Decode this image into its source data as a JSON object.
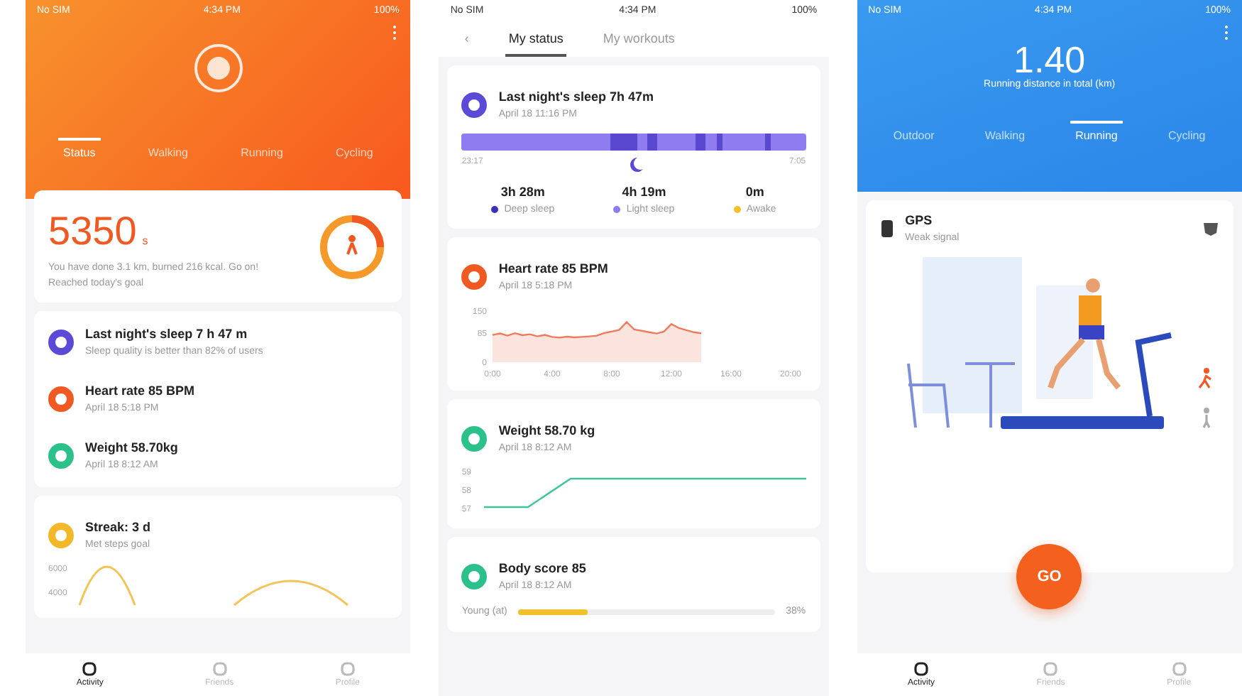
{
  "activity_screen": {
    "status_bar": {
      "carrier": "No SIM",
      "time": "4:34 PM",
      "battery": "100%"
    },
    "tabs": [
      {
        "label": "Status",
        "selected": true
      },
      {
        "label": "Walking",
        "selected": false
      },
      {
        "label": "Running",
        "selected": false
      },
      {
        "label": "Cycling",
        "selected": false
      }
    ],
    "steps": {
      "value": "5350",
      "unit": "s",
      "description": "You have done 3.1 km, burned 216 kcal. Go on!",
      "goal": "Reached today's goal"
    },
    "items": [
      {
        "title": "Last night's sleep 7 h 47 m",
        "subtitle": "Sleep quality is better than 82% of users",
        "color": "#5b4ad6"
      },
      {
        "title": "Heart rate 85 BPM",
        "subtitle": "April 18 5:18 PM",
        "color": "#f05a22"
      },
      {
        "title": "Weight 58.70kg",
        "subtitle": "April 18 8:12 AM",
        "color": "#2cc08a"
      }
    ],
    "streak": {
      "title": "Streak: 3 d",
      "subtitle": "Met steps goal",
      "color": "#f2b829",
      "yticks": [
        "6000",
        "4000"
      ]
    },
    "nav": [
      {
        "label": "Activity",
        "selected": true
      },
      {
        "label": "Friends",
        "selected": false
      },
      {
        "label": "Profile",
        "selected": false
      }
    ]
  },
  "status_screen": {
    "status_bar": {
      "carrier": "No SIM",
      "time": "4:34 PM",
      "battery": "100%"
    },
    "back": "‹",
    "tabs": [
      {
        "label": "My status",
        "selected": true
      },
      {
        "label": "My workouts",
        "selected": false
      }
    ],
    "sleep": {
      "title": "Last night's sleep 7h 47m",
      "subtitle": "April 18 11:16 PM",
      "start": "23:17",
      "end": "7:05",
      "stats": [
        {
          "value": "3h 28m",
          "label": "Deep sleep",
          "color": "#3d2fb8"
        },
        {
          "value": "4h 19m",
          "label": "Light sleep",
          "color": "#8f7cf0"
        },
        {
          "value": "0m",
          "label": "Awake",
          "color": "#f2c029"
        }
      ]
    },
    "heart": {
      "title": "Heart rate 85 BPM",
      "subtitle": "April 18 5:18 PM",
      "chart_data": {
        "type": "area",
        "x": [
          0,
          0.5,
          1,
          1.5,
          2,
          2.5,
          3,
          3.5,
          4,
          4.5,
          5,
          5.5,
          6,
          6.5,
          7,
          7.5,
          8,
          8.5,
          9,
          9.5,
          10,
          10.5,
          11,
          11.5,
          12,
          12.5,
          13,
          13.5,
          14
        ],
        "xlim": [
          0,
          20
        ],
        "ylim": [
          0,
          150
        ],
        "yticks": [
          0,
          85,
          150
        ],
        "xticks": [
          {
            "value": 0,
            "label": "0:00"
          },
          {
            "value": 4,
            "label": "4:00"
          },
          {
            "value": 8,
            "label": "8:00"
          },
          {
            "value": 12,
            "label": "12:00"
          },
          {
            "value": 16,
            "label": "16:00"
          },
          {
            "value": 20,
            "label": "20:00"
          }
        ],
        "series": [
          {
            "color": "#f07a5a",
            "values": [
              80,
              84,
              78,
              85,
              79,
              82,
              76,
              80,
              74,
              72,
              75,
              73,
              74,
              76,
              78,
              86,
              90,
              95,
              118,
              96,
              92,
              88,
              84,
              90,
              112,
              100,
              94,
              88,
              85
            ]
          }
        ]
      }
    },
    "weight": {
      "title": "Weight 58.70 kg",
      "subtitle": "April 18 8:12 AM",
      "yticks": [
        "59",
        "58",
        "57"
      ]
    },
    "body": {
      "title": "Body score 85",
      "subtitle": "April 18 8:12 AM",
      "label": "Young (at)",
      "level": 0.27,
      "reading": "38%"
    }
  },
  "workout_screen": {
    "status_bar": {
      "carrier": "No SIM",
      "time": "4:34 PM",
      "battery": "100%"
    },
    "distance": "1.40",
    "distance_label": "Running distance in total (km)",
    "tabs": [
      {
        "label": "Outdoor",
        "selected": false
      },
      {
        "label": "Walking",
        "selected": false
      },
      {
        "label": "Running",
        "selected": true
      },
      {
        "label": "Cycling",
        "selected": false
      }
    ],
    "gps": {
      "label": "GPS",
      "status": "Weak signal"
    },
    "modes": [
      {
        "kind": "run",
        "selected": true
      },
      {
        "kind": "walk",
        "selected": false
      }
    ],
    "go": "GO",
    "nav": [
      {
        "label": "Activity",
        "selected": true
      },
      {
        "label": "Friends",
        "selected": false
      },
      {
        "label": "Profile",
        "selected": false
      }
    ]
  }
}
